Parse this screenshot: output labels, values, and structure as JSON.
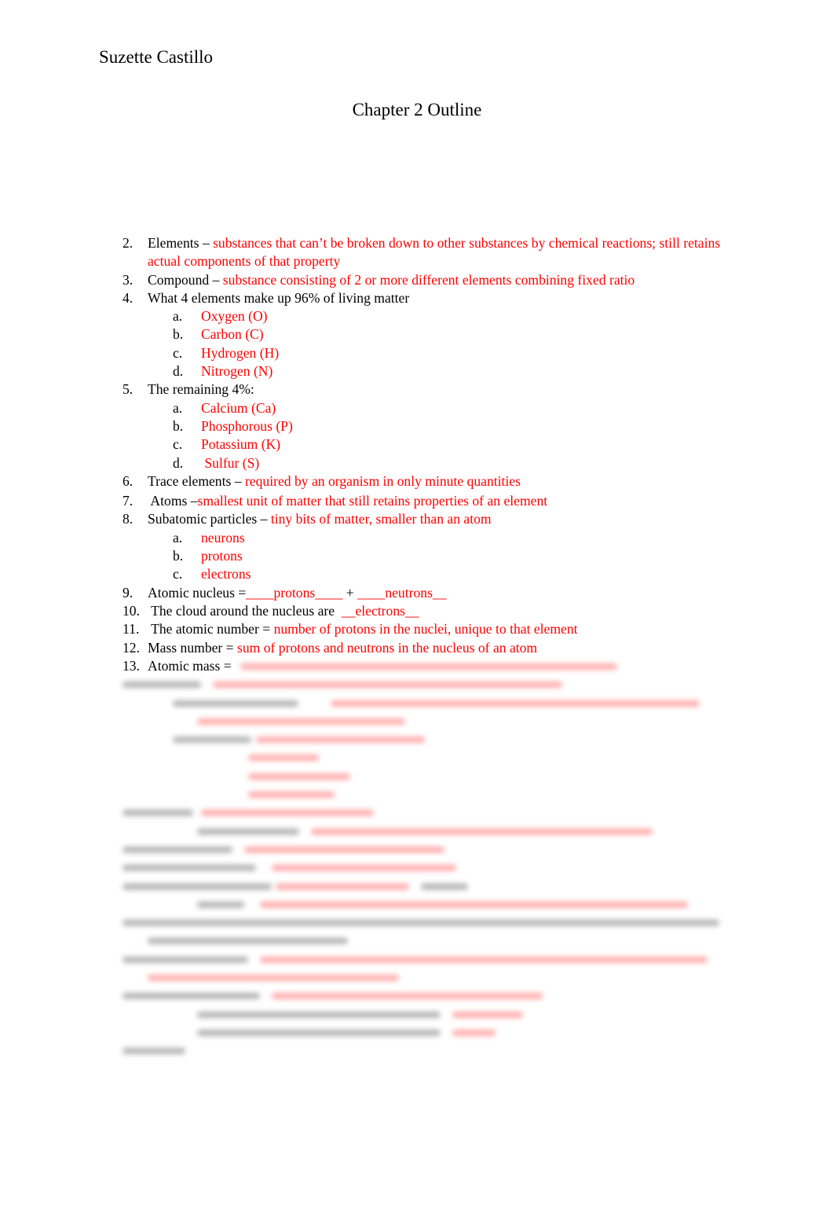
{
  "document": {
    "author": "Suzette Castillo",
    "title": "Chapter 2 Outline"
  },
  "outline": [
    {
      "num": "2.",
      "term": "Elements – ",
      "answer": "substances that can’t be broken down to other substances by chemical reactions; still retains actual components of that property"
    },
    {
      "num": "3.",
      "term": "Compound – ",
      "answer": "substance consisting of 2 or more different elements combining fixed ratio"
    },
    {
      "num": "4.",
      "term": "What 4 elements make up 96% of living matter",
      "answer": "",
      "sub": [
        {
          "letter": "a.",
          "text": "Oxygen (O)"
        },
        {
          "letter": "b.",
          "text": "Carbon (C)"
        },
        {
          "letter": "c.",
          "text": "Hydrogen (H)"
        },
        {
          "letter": "d.",
          "text": "Nitrogen (N)"
        }
      ]
    },
    {
      "num": "5.",
      "term": "The remaining 4%:",
      "answer": "",
      "sub": [
        {
          "letter": "a.",
          "text": "Calcium (Ca)"
        },
        {
          "letter": "b.",
          "text": "Phosphorous (P)"
        },
        {
          "letter": "c.",
          "text": "Potassium (K)"
        },
        {
          "letter": "d.",
          "text": " Sulfur (S)"
        }
      ]
    },
    {
      "num": "6.",
      "term": "Trace elements – ",
      "answer": " required by an organism in only minute quantities"
    },
    {
      "num": "7.",
      "term": " Atoms –",
      "answer": "smallest unit of matter that still retains properties of an element"
    },
    {
      "num": "8.",
      "term": "Subatomic particles – ",
      "answer": "tiny bits of matter, smaller than an atom",
      "sub": [
        {
          "letter": "a.",
          "text": "neurons"
        },
        {
          "letter": "b.",
          "text": "protons"
        },
        {
          "letter": "c.",
          "text": "electrons"
        }
      ]
    },
    {
      "num": "9.",
      "term": "Atomic nucleus =",
      "answer": "____protons____",
      "term2": " + ",
      "answer2": "____neutrons__"
    },
    {
      "num": "10.",
      "term": " The cloud around the nucleus are  ",
      "answer": "__electrons__"
    },
    {
      "num": "11.",
      "term": " The atomic number = ",
      "answer": "number of protons in the nuclei, unique to that element"
    },
    {
      "num": "12.",
      "term": "Mass number = ",
      "answer": "sum of protons and neutrons in the nucleus of an atom"
    },
    {
      "num": "13.",
      "term": "Atomic mass = ",
      "answer": ""
    }
  ],
  "obscured_note": "Remaining outline items 13–22 are blurred in the screenshot"
}
